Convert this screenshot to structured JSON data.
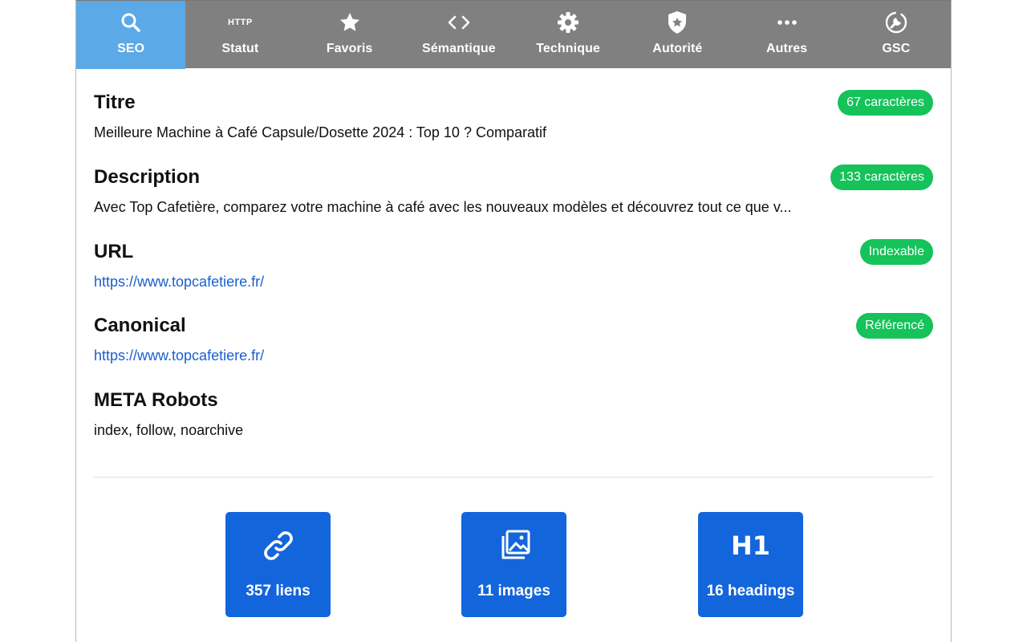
{
  "tabs": [
    {
      "label": "SEO",
      "icon": "search-icon",
      "active": true
    },
    {
      "label": "Statut",
      "icon": "http-icon",
      "icon_text": "HTTP"
    },
    {
      "label": "Favoris",
      "icon": "star-icon"
    },
    {
      "label": "Sémantique",
      "icon": "code-icon"
    },
    {
      "label": "Technique",
      "icon": "gear-icon"
    },
    {
      "label": "Autorité",
      "icon": "shield-star-icon"
    },
    {
      "label": "Autres",
      "icon": "more-icon"
    },
    {
      "label": "GSC",
      "icon": "gsc-icon"
    }
  ],
  "sections": {
    "titre": {
      "heading": "Titre",
      "value": "Meilleure Machine à Café Capsule/Dosette 2024 : Top 10 ? Comparatif",
      "badge": "67 caractères"
    },
    "description": {
      "heading": "Description",
      "value": "Avec Top Cafetière, comparez votre machine à café avec les nouveaux modèles et découvrez tout ce que v...",
      "badge": "133 caractères"
    },
    "url": {
      "heading": "URL",
      "value": "https://www.topcafetiere.fr/",
      "badge": "Indexable"
    },
    "canonical": {
      "heading": "Canonical",
      "value": "https://www.topcafetiere.fr/",
      "badge": "Référencé"
    },
    "meta_robots": {
      "heading": "META Robots",
      "value": "index, follow, noarchive"
    }
  },
  "cards": [
    {
      "label": "357 liens",
      "icon": "link-icon"
    },
    {
      "label": "11 images",
      "icon": "images-icon"
    },
    {
      "label": "16 headings",
      "icon": "h1-icon",
      "icon_text": "H1"
    }
  ],
  "colors": {
    "topbar": "#808080",
    "active_tab": "#5ba9e6",
    "badge_green": "#16c25a",
    "card_blue": "#1365dc",
    "link_blue": "#1a5fd0"
  }
}
